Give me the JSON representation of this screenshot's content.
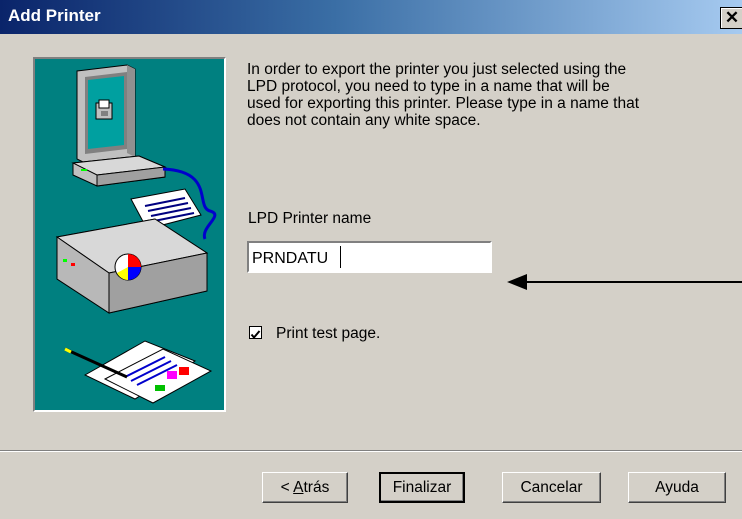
{
  "window": {
    "title": "Add Printer",
    "close_glyph": "✕"
  },
  "description": {
    "lines": [
      "In order to export the printer you just selected using the",
      "LPD protocol, you need to type in a name that will be",
      "used for exporting this printer. Please type in a name that",
      "does not contain any white space."
    ]
  },
  "printer_name": {
    "label": "LPD Printer name",
    "value": "PRNDATU"
  },
  "print_test_page": {
    "label": "Print test page.",
    "checked": true
  },
  "buttons": {
    "back": {
      "prefix": "< ",
      "accel": "A",
      "rest": "trás"
    },
    "finish": "Finalizar",
    "cancel": "Cancelar",
    "help": "Ayuda"
  },
  "illustration": {
    "icons": [
      "computer-icon",
      "printer-icon",
      "printed-pages-icon"
    ],
    "background": "#008080"
  },
  "colors": {
    "title_bar_start": "#0a246a",
    "title_bar_end": "#a6caf0",
    "dialog_face": "#d4d0c8"
  }
}
